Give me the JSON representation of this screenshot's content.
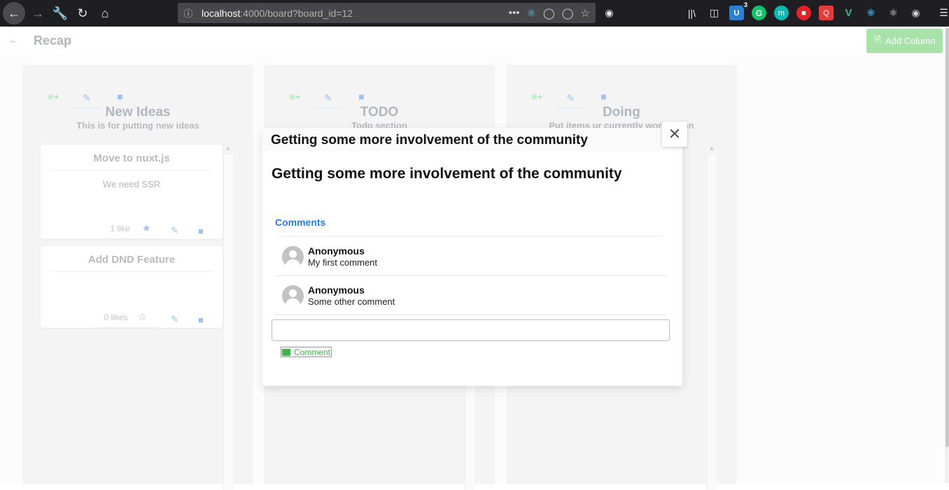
{
  "browser": {
    "url_host": "localhost",
    "url_rest": ":4000/board?board_id=12",
    "ext_badge": "3"
  },
  "header": {
    "title": "Recap",
    "add_column_label": "Add Column"
  },
  "columns": [
    {
      "title": "New Ideas",
      "description": "This is for putting new ideas",
      "cards": [
        {
          "title": "Move to nuxt.js",
          "body": "We need SSR",
          "likes": "1 like"
        },
        {
          "title": "Add DND Feature",
          "body": "",
          "likes": "0 likes"
        }
      ]
    },
    {
      "title": "TODO",
      "description": "Todo section"
    },
    {
      "title": "Doing",
      "description": "Put items ur currently working on"
    }
  ],
  "modal": {
    "header_title": "Getting some more involvement of the community",
    "title": "Getting some more involvement of the community",
    "comments_label": "Comments",
    "comments": [
      {
        "author": "Anonymous",
        "text": "My first comment"
      },
      {
        "author": "Anonymous",
        "text": "Some other comment"
      }
    ],
    "input_placeholder": "",
    "comment_button": "Comment"
  },
  "colors": {
    "accent_blue": "#2b7be0",
    "accent_green": "#3fb44a",
    "add_column_bg": "#a7e3a9"
  }
}
